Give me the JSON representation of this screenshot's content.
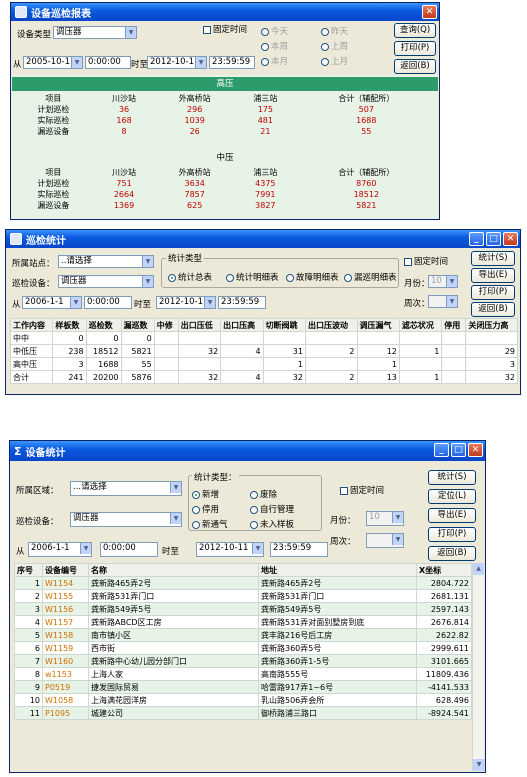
{
  "w1": {
    "title": "设备巡检报表",
    "device_label": "设备类型",
    "device_value": "调压器",
    "fixed_time": "固定时间",
    "opts": [
      "今天",
      "本周",
      "本月",
      "昨天",
      "上周",
      "上月"
    ],
    "query": "查询(Q)",
    "print": "打印(P)",
    "back": "返回(B)",
    "from": "从",
    "from_date": "2005-10-11",
    "from_time": "0:00:00",
    "to": "时至",
    "to_date": "2012-10-11",
    "to_time": "23:59:59",
    "sec1": "高压",
    "sec2": "中压",
    "headers": [
      "项目",
      "川沙站",
      "外高桥站",
      "浦三站",
      "合计（辅配所）"
    ],
    "rows1": [
      [
        "计划巡检",
        "36",
        "296",
        "175",
        "507"
      ],
      [
        "实际巡检",
        "168",
        "1039",
        "481",
        "1688"
      ],
      [
        "漏巡设备",
        "8",
        "26",
        "21",
        "55"
      ]
    ],
    "rows2": [
      [
        "计划巡检",
        "751",
        "3634",
        "4375",
        "8760"
      ],
      [
        "实际巡检",
        "2664",
        "7857",
        "7991",
        "18512"
      ],
      [
        "漏巡设备",
        "1369",
        "625",
        "3827",
        "5821"
      ]
    ]
  },
  "w2": {
    "title": "巡检统计",
    "station_label": "所属站点：",
    "station_value": "..请选择",
    "device_label": "巡检设备：",
    "device_value": "调压器",
    "type_group": "统计类型",
    "types": [
      "统计总表",
      "统计明细表",
      "故障明细表",
      "漏巡明细表"
    ],
    "fixed_time": "固定时间",
    "month": "月份：",
    "month_value": "10",
    "week": "周次：",
    "btns": [
      "统计(S)",
      "导出(E)",
      "打印(P)",
      "返回(B)"
    ],
    "from": "从",
    "from_date": "2006-1-1",
    "from_time": "0:00:00",
    "to": "时至",
    "to_date": "2012-10-11",
    "to_time": "23:59:59",
    "cols": [
      "工作内容",
      "样板数",
      "巡检数",
      "漏巡数",
      "中修",
      "出口压低",
      "出口压高",
      "切断阀跳",
      "出口压波动",
      "调压漏气",
      "滤芯状况",
      "停用",
      "关闭压力高"
    ],
    "rows": [
      [
        "中中",
        "0",
        "0",
        "0",
        "",
        "",
        "",
        "",
        "",
        "",
        "",
        "",
        ""
      ],
      [
        "中低压",
        "238",
        "18512",
        "5821",
        "",
        "32",
        "4",
        "31",
        "2",
        "12",
        "1",
        "",
        "29"
      ],
      [
        "高中压",
        "3",
        "1688",
        "55",
        "",
        "",
        "",
        "1",
        "",
        "1",
        "",
        "",
        "3"
      ],
      [
        "合计",
        "241",
        "20200",
        "5876",
        "",
        "32",
        "4",
        "32",
        "2",
        "13",
        "1",
        "",
        "32"
      ]
    ]
  },
  "w3": {
    "title": "设备统计",
    "area_label": "所属区域：",
    "area_value": "...请选择",
    "device_label": "巡检设备：",
    "device_value": "调压器",
    "type_group": "统计类型：",
    "types": [
      "新增",
      "废除",
      "停用",
      "自行管理",
      "新通气",
      "未入样板"
    ],
    "fixed_time": "固定时间",
    "month": "月份：",
    "month_value": "10",
    "week": "周次：",
    "btns": [
      "统计(S)",
      "定位(L)",
      "导出(E)",
      "打印(P)",
      "返回(B)"
    ],
    "from": "从",
    "from_date": "2006-1-1",
    "from_time": "0:00:00",
    "to": "时至",
    "to_date": "2012-10-11",
    "to_time": "23:59:59",
    "cols": [
      "序号",
      "设备编号",
      "名称",
      "地址",
      "X坐标"
    ],
    "rows": [
      [
        "1",
        "W1154",
        "龚新路465弄2号",
        "龚新路465弄2号",
        "2804.722"
      ],
      [
        "2",
        "W1155",
        "龚新路531弄门口",
        "龚新路531弄门口",
        "2681.131"
      ],
      [
        "3",
        "W1156",
        "龚新路549弄5号",
        "龚新路549弄5号",
        "2597.143"
      ],
      [
        "4",
        "W1157",
        "龚新路ABCD区工房",
        "龚新路531弄对面别墅房到底",
        "2676.814"
      ],
      [
        "5",
        "W1158",
        "南市镇小区",
        "龚丰路216号后工房",
        "2622.82"
      ],
      [
        "6",
        "W1159",
        "西市街",
        "龚新路360弄5号",
        "2999.611"
      ],
      [
        "7",
        "W1160",
        "龚新路中心幼儿园分部门口",
        "龚新路360弄1-5号",
        "3101.665"
      ],
      [
        "8",
        "w1153",
        "上海人家",
        "高南路555号",
        "11809.436"
      ],
      [
        "9",
        "P0519",
        "捷发国际贸易",
        "哈雷路917弄1~6号",
        "-4141.533"
      ],
      [
        "10",
        "W1058",
        "上海满花园洋房",
        "乳山路506弄会所",
        "628.496"
      ],
      [
        "11",
        "P1095",
        "城建公司",
        "御桥路浦三路口",
        "-8924.541"
      ]
    ]
  }
}
